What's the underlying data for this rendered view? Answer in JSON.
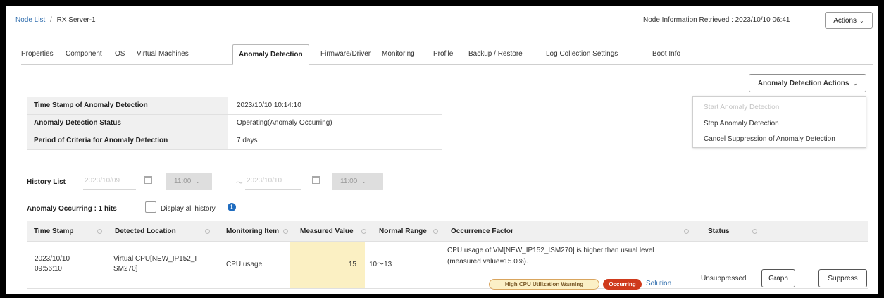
{
  "breadcrumb": {
    "parent": "Node List",
    "separator": "/",
    "current": "RX Server-1"
  },
  "header": {
    "retrieved": "Node Information Retrieved : 2023/10/10 06:41",
    "actions_label": "Actions"
  },
  "tabs": [
    {
      "label": "Properties",
      "active": false
    },
    {
      "label": "Component",
      "active": false
    },
    {
      "label": "OS",
      "active": false
    },
    {
      "label": "Virtual Machines",
      "active": false
    },
    {
      "label": "Anomaly Detection",
      "active": true
    },
    {
      "label": "Firmware/Driver",
      "active": false
    },
    {
      "label": "Monitoring",
      "active": false
    },
    {
      "label": "Profile",
      "active": false
    },
    {
      "label": "Backup / Restore",
      "active": false
    },
    {
      "label": "Log Collection Settings",
      "active": false
    },
    {
      "label": "Boot Info",
      "active": false
    }
  ],
  "anomaly_actions": {
    "label": "Anomaly Detection Actions",
    "menu": [
      {
        "label": "Start Anomaly Detection",
        "disabled": true
      },
      {
        "label": "Stop Anomaly Detection",
        "disabled": false
      },
      {
        "label": "Cancel Suppression of Anomaly Detection",
        "disabled": false
      }
    ]
  },
  "info": [
    {
      "key": "Time Stamp of Anomaly Detection",
      "value": "2023/10/10 10:14:10"
    },
    {
      "key": "Anomaly Detection Status",
      "value": "Operating(Anomaly Occurring)"
    },
    {
      "key": "Period of Criteria for Anomaly Detection",
      "value": "7 days"
    }
  ],
  "history": {
    "label": "History List",
    "from_date": "2023/10/09",
    "from_time": "11:00",
    "range_sep": "～",
    "to_date": "2023/10/10",
    "to_time": "11:00"
  },
  "filter": {
    "hits_label": "Anomaly Occurring : 1 hits",
    "display_all_label": "Display all history",
    "display_all_checked": false,
    "info_glyph": "i"
  },
  "table": {
    "columns": [
      "Time Stamp",
      "Detected Location",
      "Monitoring Item",
      "Measured Value",
      "Normal Range",
      "Occurrence Factor",
      "Status"
    ],
    "rows": [
      {
        "timestamp_date": "2023/10/10",
        "timestamp_time": "09:56:10",
        "location_line1": "Virtual CPU[NEW_IP152_I",
        "location_line2": "SM270]",
        "item": "CPU usage",
        "measured": "15",
        "normal_range": "10～13",
        "factor_line1": "CPU usage of VM[NEW_IP152_ISM270] is higher than usual level",
        "factor_line2": "(measured value=15.0%).",
        "warning_badge": "High CPU Utilization Warning",
        "occurring_badge": "Occurring",
        "solution_link": "Solution",
        "status": "Unsuppressed",
        "graph_button": "Graph",
        "suppress_button": "Suppress"
      }
    ]
  },
  "colors": {
    "link": "#2f6dad",
    "occurring": "#cf3a1c",
    "warning_bg": "#fbf0c6",
    "measured_bg": "#fbf0c3",
    "info_icon": "#1f6cbf"
  }
}
